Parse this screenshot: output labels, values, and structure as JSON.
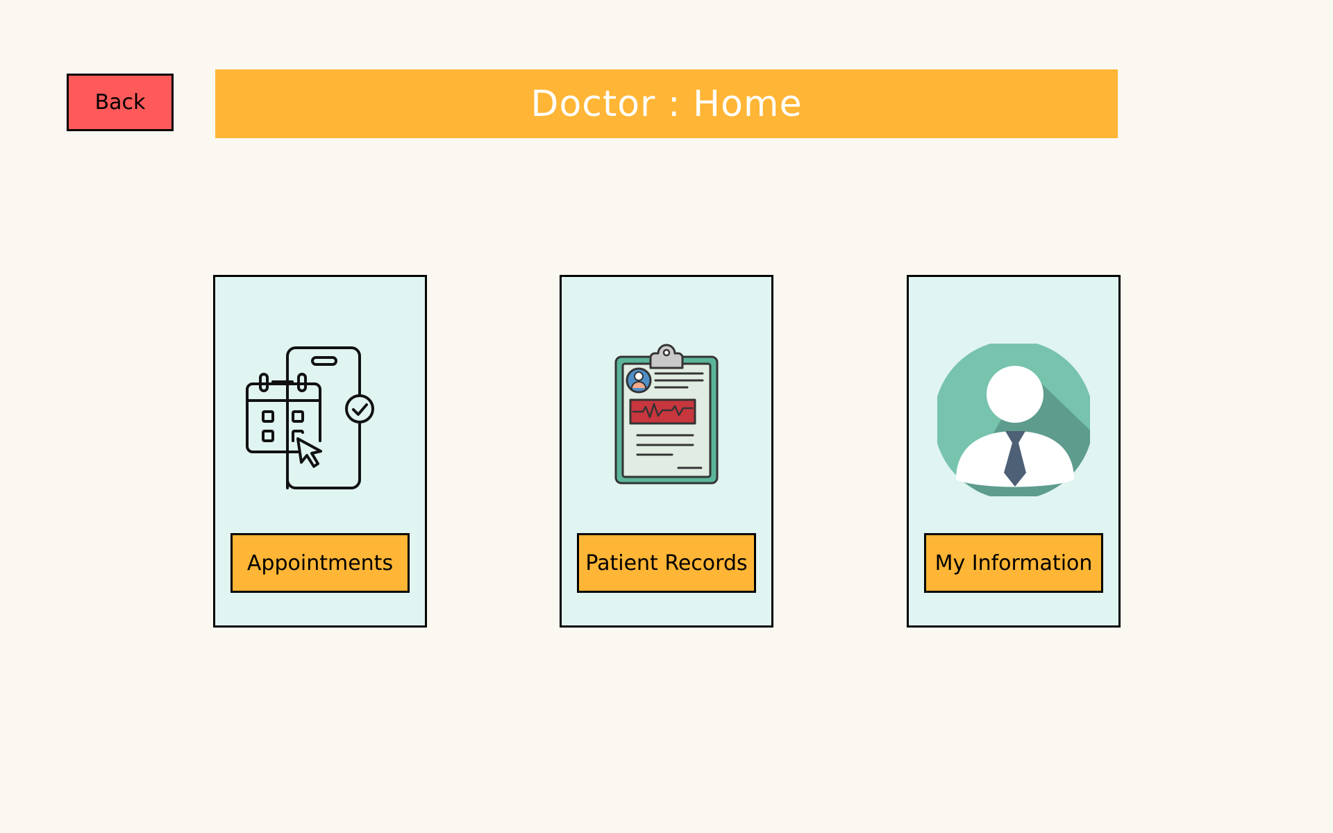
{
  "header": {
    "back_label": "Back",
    "title": "Doctor : Home"
  },
  "cards": [
    {
      "label": "Appointments",
      "icon": "appointment-calendar-icon"
    },
    {
      "label": "Patient Records",
      "icon": "clipboard-record-icon"
    },
    {
      "label": "My Information",
      "icon": "user-profile-icon"
    }
  ],
  "colors": {
    "background": "#faf8f1",
    "accent": "#ffb535",
    "back_button": "#fe5a5a",
    "card_background": "#e0f4f1",
    "title_text": "#ffffff"
  }
}
